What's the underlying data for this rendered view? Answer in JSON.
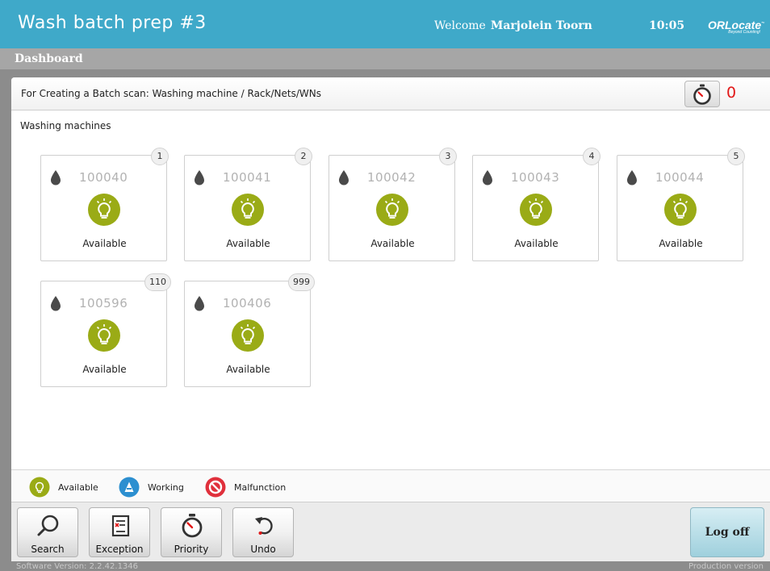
{
  "header": {
    "title": "Wash batch prep #3",
    "welcome_label": "Welcome",
    "user_name": "Marjolein Toorn",
    "time": "10:05",
    "logo_text": "ORLocate",
    "logo_tagline": "Beyond Counting!"
  },
  "breadcrumb": "Dashboard",
  "instruction": "For Creating a Batch scan: Washing machine / Rack/Nets/WNs",
  "priority_count": "0",
  "section_label": "Washing machines",
  "machines": [
    {
      "badge": "1",
      "id": "100040",
      "status": "Available"
    },
    {
      "badge": "2",
      "id": "100041",
      "status": "Available"
    },
    {
      "badge": "3",
      "id": "100042",
      "status": "Available"
    },
    {
      "badge": "4",
      "id": "100043",
      "status": "Available"
    },
    {
      "badge": "5",
      "id": "100044",
      "status": "Available"
    },
    {
      "badge": "110",
      "id": "100596",
      "status": "Available"
    },
    {
      "badge": "999",
      "id": "100406",
      "status": "Available"
    }
  ],
  "legend": {
    "available": "Available",
    "working": "Working",
    "malfunction": "Malfunction"
  },
  "toolbar": {
    "search": "Search",
    "exception": "Exception",
    "priority": "Priority",
    "undo": "Undo",
    "logoff": "Log off"
  },
  "footer": {
    "version": "Software Version: 2.2.42.1346",
    "mode": "Production version"
  },
  "colors": {
    "header": "#3fa9c9",
    "available": "#9aab16",
    "working": "#2c8fd0",
    "malfunction": "#e0303c",
    "priority_count": "#e21818"
  },
  "icons": {
    "machine": "water-drop-icon",
    "available": "lightbulb-icon",
    "priority": "stopwatch-icon",
    "search": "magnifier-icon",
    "exception": "document-x-icon",
    "undo": "undo-icon"
  }
}
